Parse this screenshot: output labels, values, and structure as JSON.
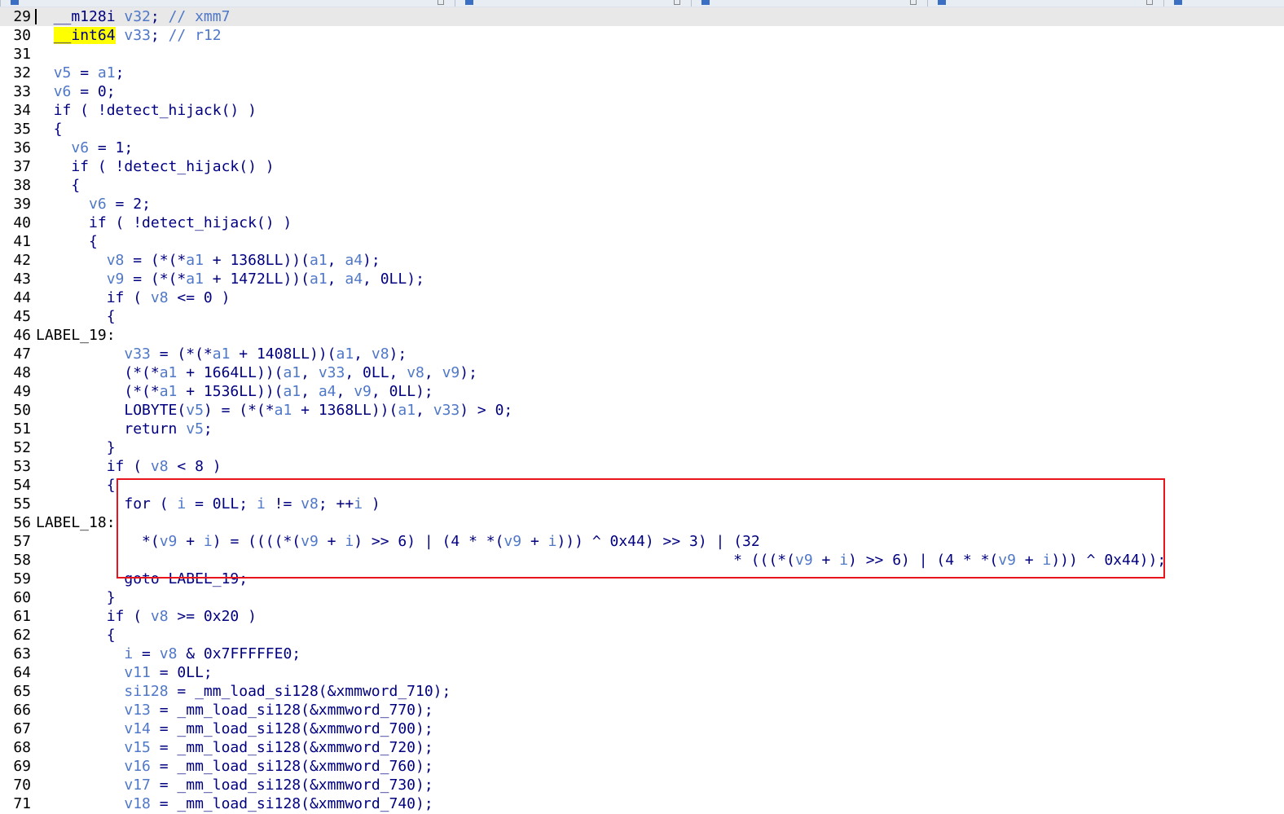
{
  "colors": {
    "keyword_text": "#000080",
    "variable_text": "#5078c8",
    "line_number_text": "#000000",
    "identifier_highlight": "#ffff00",
    "annotation_box": "#e8161c",
    "current_line_background": "#e8e8e8"
  },
  "tabs": [
    {
      "icon": "pseudocode-view-icon"
    },
    {
      "icon": "hex-view-icon"
    },
    {
      "icon": "structures-icon"
    },
    {
      "icon": "enums-icon"
    },
    {
      "icon": "imports-icon"
    }
  ],
  "highlighted_identifier": "__int64",
  "annotation": {
    "description_hidden": true,
    "first_line": 55,
    "last_line": 59
  },
  "lines": [
    {
      "n": "29",
      "t": "  __m128i v32; // xmm7"
    },
    {
      "n": "30",
      "t": "  __int64 v33; // r12"
    },
    {
      "n": "31",
      "t": ""
    },
    {
      "n": "32",
      "t": "  v5 = a1;"
    },
    {
      "n": "33",
      "t": "  v6 = 0;"
    },
    {
      "n": "34",
      "t": "  if ( !detect_hijack() )"
    },
    {
      "n": "35",
      "t": "  {"
    },
    {
      "n": "36",
      "t": "    v6 = 1;"
    },
    {
      "n": "37",
      "t": "    if ( !detect_hijack() )"
    },
    {
      "n": "38",
      "t": "    {"
    },
    {
      "n": "39",
      "t": "      v6 = 2;"
    },
    {
      "n": "40",
      "t": "      if ( !detect_hijack() )"
    },
    {
      "n": "41",
      "t": "      {"
    },
    {
      "n": "42",
      "t": "        v8 = (*(*a1 + 1368LL))(a1, a4);"
    },
    {
      "n": "43",
      "t": "        v9 = (*(*a1 + 1472LL))(a1, a4, 0LL);"
    },
    {
      "n": "44",
      "t": "        if ( v8 <= 0 )"
    },
    {
      "n": "45",
      "t": "        {"
    },
    {
      "n": "46",
      "t": "LABEL_19:"
    },
    {
      "n": "47",
      "t": "          v33 = (*(*a1 + 1408LL))(a1, v8);"
    },
    {
      "n": "48",
      "t": "          (*(*a1 + 1664LL))(a1, v33, 0LL, v8, v9);"
    },
    {
      "n": "49",
      "t": "          (*(*a1 + 1536LL))(a1, a4, v9, 0LL);"
    },
    {
      "n": "50",
      "t": "          LOBYTE(v5) = (*(*a1 + 1368LL))(a1, v33) > 0;"
    },
    {
      "n": "51",
      "t": "          return v5;"
    },
    {
      "n": "52",
      "t": "        }"
    },
    {
      "n": "53",
      "t": "        if ( v8 < 8 )"
    },
    {
      "n": "54",
      "t": "        {"
    },
    {
      "n": "55",
      "t": "          for ( i = 0LL; i != v8; ++i )"
    },
    {
      "n": "56",
      "t": "LABEL_18:"
    },
    {
      "n": "57",
      "t": "            *(v9 + i) = ((((*(v9 + i) >> 6) | (4 * *(v9 + i))) ^ 0x44) >> 3) | (32"
    },
    {
      "n": "58",
      "t": "                                                                               * (((*(v9 + i) >> 6) | (4 * *(v9 + i))) ^ 0x44));"
    },
    {
      "n": "59",
      "t": "          goto LABEL_19;"
    },
    {
      "n": "60",
      "t": "        }"
    },
    {
      "n": "61",
      "t": "        if ( v8 >= 0x20 )"
    },
    {
      "n": "62",
      "t": "        {"
    },
    {
      "n": "63",
      "t": "          i = v8 & 0x7FFFFFE0;"
    },
    {
      "n": "64",
      "t": "          v11 = 0LL;"
    },
    {
      "n": "65",
      "t": "          si128 = _mm_load_si128(&xmmword_710);"
    },
    {
      "n": "66",
      "t": "          v13 = _mm_load_si128(&xmmword_770);"
    },
    {
      "n": "67",
      "t": "          v14 = _mm_load_si128(&xmmword_700);"
    },
    {
      "n": "68",
      "t": "          v15 = _mm_load_si128(&xmmword_720);"
    },
    {
      "n": "69",
      "t": "          v16 = _mm_load_si128(&xmmword_760);"
    },
    {
      "n": "70",
      "t": "          v17 = _mm_load_si128(&xmmword_730);"
    },
    {
      "n": "71",
      "t": "          v18 = _mm_load_si128(&xmmword_740);"
    }
  ]
}
